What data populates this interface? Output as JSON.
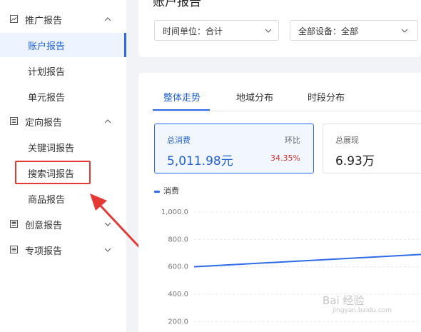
{
  "sidebar": {
    "groups": [
      {
        "label": "推广报告",
        "icon": "chart-icon",
        "expanded": true
      },
      {
        "label": "定向报告",
        "icon": "list-icon",
        "expanded": true
      },
      {
        "label": "创意报告",
        "icon": "doc-icon",
        "expanded": false
      },
      {
        "label": "专项报告",
        "icon": "list-icon",
        "expanded": false
      }
    ],
    "items": [
      {
        "label": "账户报告",
        "active": true
      },
      {
        "label": "计划报告"
      },
      {
        "label": "单元报告"
      },
      {
        "label": "关键词报告"
      },
      {
        "label": "搜索词报告"
      },
      {
        "label": "商品报告"
      }
    ]
  },
  "header": {
    "title": "账户报告",
    "time_unit": "时间单位：合计",
    "device": "全部设备：全部"
  },
  "tabs": [
    "整体走势",
    "地域分布",
    "时段分布"
  ],
  "metrics": {
    "primary": {
      "label": "总消费",
      "value": "5,011.98元",
      "compare_label": "环比",
      "compare_value": "34.35%"
    },
    "secondary": {
      "label": "总展现",
      "value": "6.93万"
    }
  },
  "legend": {
    "series_name": "消费"
  },
  "chart_data": {
    "type": "line",
    "yticks": [
      "1,000.0",
      "800.0",
      "600.0",
      "400.0",
      "200.0"
    ],
    "ylim": [
      0,
      1000
    ],
    "series": [
      {
        "name": "消费",
        "values": [
          600,
          690
        ]
      }
    ],
    "color": "#2e6be6"
  },
  "annotation_color": "#e53935",
  "watermark": {
    "text": "Bai 经验",
    "sub": "jingyan.baidu.com"
  }
}
